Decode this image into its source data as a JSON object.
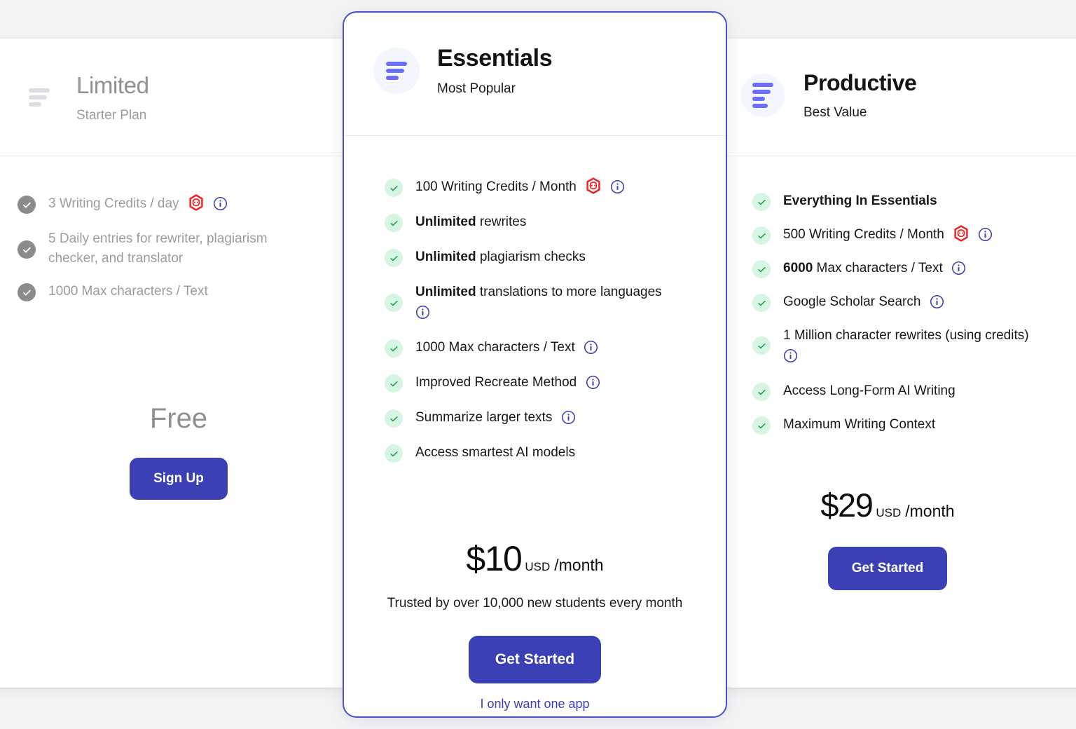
{
  "page": {
    "background_color": "#f5f4f5",
    "accent_color": "#3b41b5",
    "logo_bar_color": "#6c6ff5",
    "check_green_bg": "#d6f5e2",
    "check_gray_bg": "#8b8b8e",
    "robot_icon_color": "#f41b1b",
    "info_icon_color": "#3b41b5"
  },
  "plans": [
    {
      "id": "limited",
      "name": "Limited",
      "tagline": "Starter Plan",
      "logo_icon": "text-lines-icon",
      "features": [
        {
          "text": "3 Writing Credits / day",
          "bold_prefix": "",
          "icons": [
            "robot-icon",
            "info-icon"
          ]
        },
        {
          "text": "5 Daily entries for rewriter, plagiarism checker, and translator",
          "bold_prefix": "",
          "icons": []
        },
        {
          "text": "1000 Max characters / Text",
          "bold_prefix": "",
          "icons": []
        }
      ],
      "price_label": "Free",
      "cta_label": "Sign Up"
    },
    {
      "id": "essentials",
      "name": "Essentials",
      "tagline": "Most Popular",
      "logo_icon": "text-lines-icon",
      "features": [
        {
          "bold_prefix": "",
          "text": "100 Writing Credits / Month",
          "icons": [
            "robot-icon",
            "info-icon"
          ]
        },
        {
          "bold_prefix": "Unlimited",
          "text": " rewrites",
          "icons": []
        },
        {
          "bold_prefix": "Unlimited",
          "text": " plagiarism checks",
          "icons": []
        },
        {
          "bold_prefix": "Unlimited",
          "text": " translations to more languages",
          "icons": [
            "info-icon"
          ]
        },
        {
          "bold_prefix": "",
          "text": "1000 Max characters / Text",
          "icons": [
            "info-icon"
          ]
        },
        {
          "bold_prefix": "",
          "text": "Improved Recreate Method",
          "icons": [
            "info-icon"
          ]
        },
        {
          "bold_prefix": "",
          "text": "Summarize larger texts",
          "icons": [
            "info-icon"
          ]
        },
        {
          "bold_prefix": "",
          "text": "Access smartest AI models",
          "icons": []
        }
      ],
      "price_amount": "$10",
      "price_currency": "USD",
      "price_period": "/month",
      "trusted_note": "Trusted by over 10,000 new students every month",
      "cta_label": "Get Started",
      "sub_link_label": "I only want one app"
    },
    {
      "id": "productive",
      "name": "Productive",
      "tagline": "Best Value",
      "logo_icon": "text-lines-icon",
      "features": [
        {
          "bold_prefix": "Everything In Essentials",
          "text": "",
          "icons": []
        },
        {
          "bold_prefix": "",
          "text": "500 Writing Credits / Month",
          "icons": [
            "robot-icon",
            "info-icon"
          ]
        },
        {
          "bold_prefix": "6000",
          "text": " Max characters / Text",
          "icons": [
            "info-icon"
          ]
        },
        {
          "bold_prefix": "",
          "text": "Google Scholar Search",
          "icons": [
            "info-icon"
          ]
        },
        {
          "bold_prefix": "",
          "text": "1 Million character rewrites (using credits)",
          "icons": [
            "info-icon"
          ]
        },
        {
          "bold_prefix": "",
          "text": "Access Long-Form AI Writing",
          "icons": []
        },
        {
          "bold_prefix": "",
          "text": "Maximum Writing Context",
          "icons": []
        }
      ],
      "price_amount": "$29",
      "price_currency": "USD",
      "price_period": "/month",
      "cta_label": "Get Started"
    }
  ]
}
